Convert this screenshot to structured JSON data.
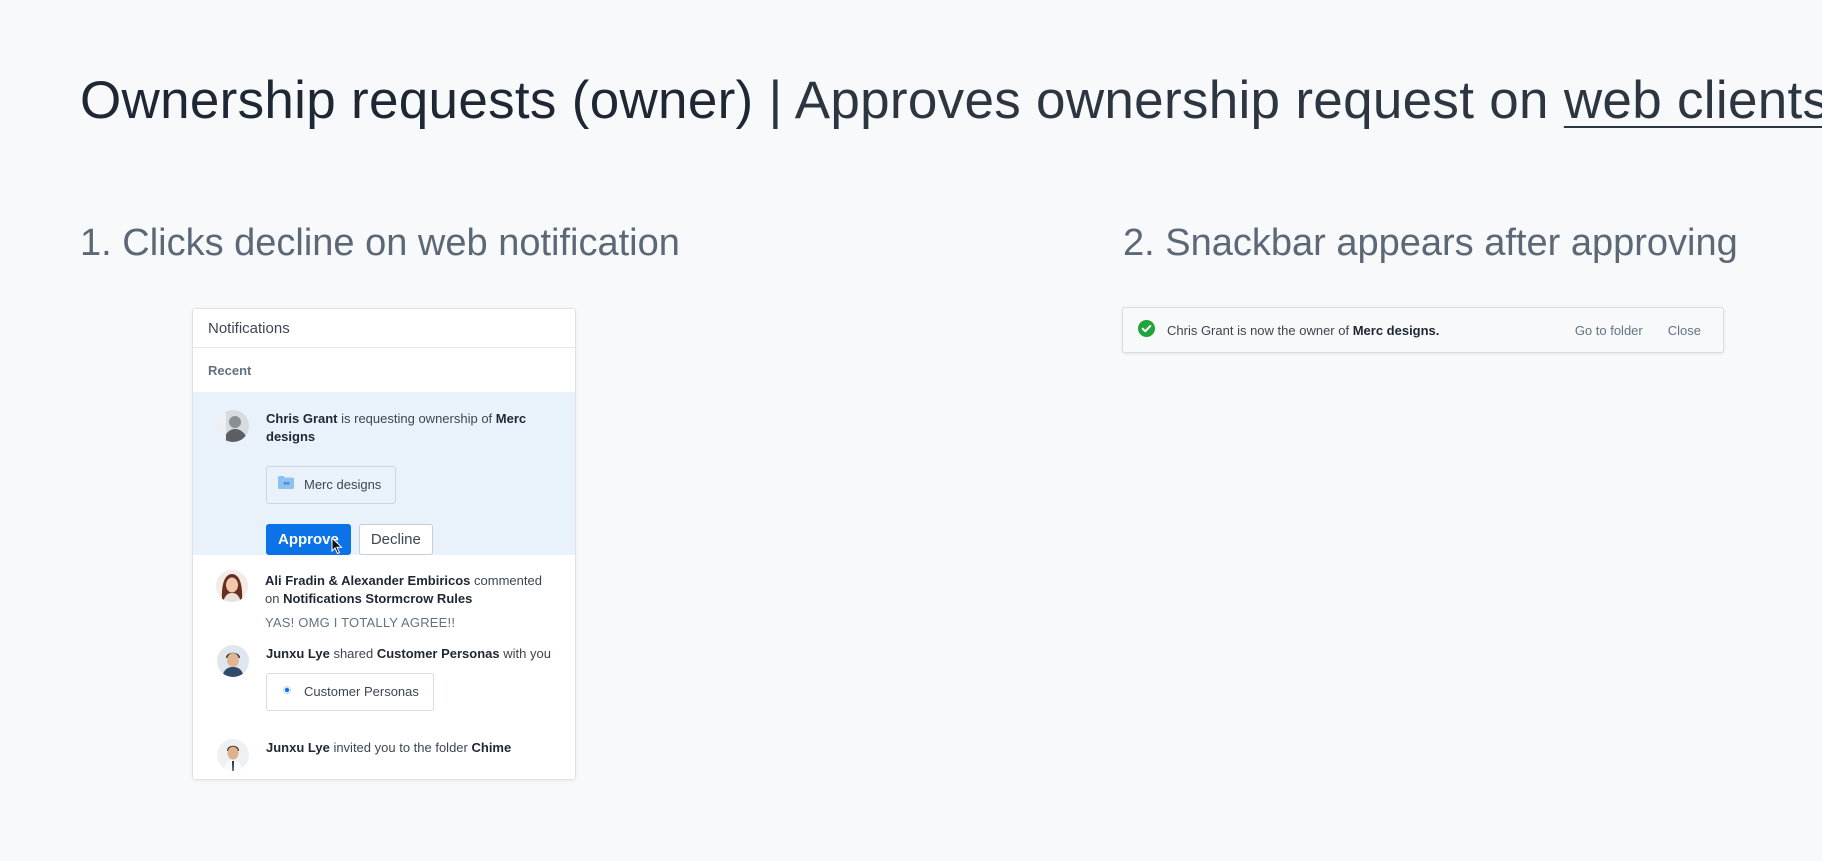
{
  "page": {
    "title_main": "Ownership requests (owner)",
    "title_sep": " | ",
    "title_sub": "Approves ownership request on ",
    "title_link": "web clients",
    "step1": "1. Clicks decline on web notification",
    "step2": "2. Snackbar appears after approving"
  },
  "notifications": {
    "header": "Notifications",
    "section": "Recent",
    "items": [
      {
        "actor": "Chris Grant",
        "text": " is requesting ownership of ",
        "target": "Merc designs",
        "chip_label": "Merc designs",
        "approve_label": "Approve",
        "decline_label": "Decline"
      },
      {
        "actor": "Ali Fradin & Alexander Embiricos",
        "text": " commented on ",
        "target": "Notifications Stormcrow Rules",
        "quote": "YAS! OMG I TOTALLY AGREE!!"
      },
      {
        "actor": "Junxu Lye",
        "text": " shared ",
        "target": "Customer Personas",
        "text2": " with you",
        "chip_label": "Customer Personas"
      },
      {
        "actor": "Junxu Lye",
        "text": " invited you to the folder ",
        "target": "Chime"
      }
    ]
  },
  "snackbar": {
    "message_prefix": "Chris Grant is now the owner of ",
    "message_target": "Merc designs.",
    "go_to_folder": "Go to folder",
    "close": "Close"
  },
  "colors": {
    "primary": "#0b72e7",
    "success": "#1fa53b",
    "background": "#f7f9fb"
  }
}
